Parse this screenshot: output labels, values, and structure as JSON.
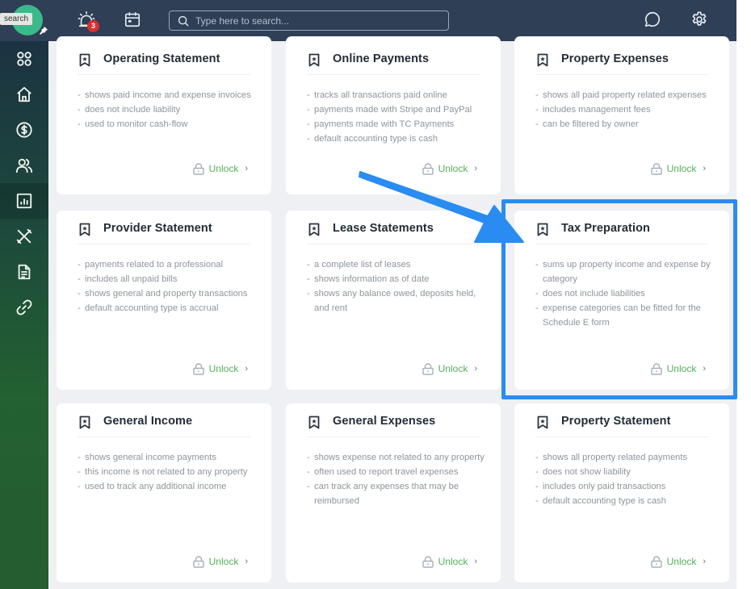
{
  "topbar": {
    "tooltip": "search",
    "notification_count": "3",
    "search_placeholder": "Type here to search...",
    "icons": [
      "logo",
      "alarm-icon",
      "calendar-icon",
      "search-icon",
      "chat-icon",
      "gear-icon"
    ]
  },
  "sidebar": {
    "items": [
      {
        "name": "apps",
        "icon": "apps-grid-icon"
      },
      {
        "name": "home",
        "icon": "home-icon"
      },
      {
        "name": "payments",
        "icon": "dollar-circle-icon"
      },
      {
        "name": "contacts",
        "icon": "users-icon"
      },
      {
        "name": "reports",
        "icon": "bar-chart-icon",
        "active": true
      },
      {
        "name": "maintenance",
        "icon": "tools-icon"
      },
      {
        "name": "documents",
        "icon": "document-icon"
      },
      {
        "name": "links",
        "icon": "link-icon"
      }
    ]
  },
  "cards": [
    {
      "title": "Operating Statement",
      "items": [
        "shows paid income and expense invoices",
        "does not include liability",
        "used to monitor cash-flow"
      ],
      "action": "Unlock"
    },
    {
      "title": "Online Payments",
      "items": [
        "tracks all transactions paid online",
        "payments made with Stripe and PayPal",
        "payments made with TC Payments",
        "default accounting type is cash"
      ],
      "action": "Unlock"
    },
    {
      "title": "Property Expenses",
      "items": [
        "shows all paid property related expenses",
        "includes management fees",
        "can be filtered by owner"
      ],
      "action": "Unlock"
    },
    {
      "title": "Provider Statement",
      "items": [
        "payments related to a professional",
        "includes all unpaid bills",
        "shows general and property transactions",
        "default accounting type is accrual"
      ],
      "action": "Unlock"
    },
    {
      "title": "Lease Statements",
      "items": [
        "a complete list of leases",
        "shows information as of date",
        "shows any balance owed, deposits held, and rent"
      ],
      "action": "Unlock"
    },
    {
      "title": "Tax Preparation",
      "items": [
        "sums up property income and expense by category",
        "does not include liabilities",
        "expense categories can be fitted for the Schedule E form"
      ],
      "action": "Unlock",
      "highlighted": true
    },
    {
      "title": "General Income",
      "items": [
        "shows general income payments",
        "this income is not related to any property",
        "used to track any additional income"
      ],
      "action": "Unlock"
    },
    {
      "title": "General Expenses",
      "items": [
        "shows expense not related to any property",
        "often used to report travel expenses",
        "can track any expenses that may be reimbursed"
      ],
      "action": "Unlock"
    },
    {
      "title": "Property Statement",
      "items": [
        "shows all property related payments",
        "does not show liability",
        "includes only paid transactions",
        "default accounting type is cash"
      ],
      "action": "Unlock"
    }
  ],
  "colors": {
    "topbar": "#2e3f56",
    "accent_green": "#54b05a",
    "highlight_blue": "#2a8cf0",
    "badge_red": "#d9302f"
  }
}
